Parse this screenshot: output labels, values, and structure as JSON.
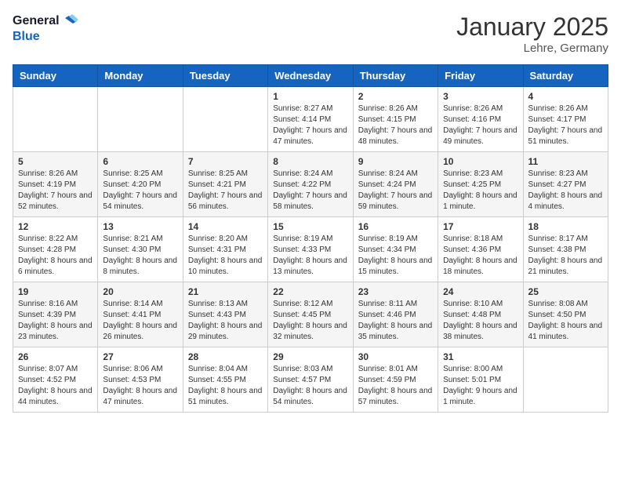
{
  "header": {
    "logo_general": "General",
    "logo_blue": "Blue",
    "month": "January 2025",
    "location": "Lehre, Germany"
  },
  "days_of_week": [
    "Sunday",
    "Monday",
    "Tuesday",
    "Wednesday",
    "Thursday",
    "Friday",
    "Saturday"
  ],
  "weeks": [
    [
      {
        "day": "",
        "sunrise": "",
        "sunset": "",
        "daylight": ""
      },
      {
        "day": "",
        "sunrise": "",
        "sunset": "",
        "daylight": ""
      },
      {
        "day": "",
        "sunrise": "",
        "sunset": "",
        "daylight": ""
      },
      {
        "day": "1",
        "sunrise": "Sunrise: 8:27 AM",
        "sunset": "Sunset: 4:14 PM",
        "daylight": "Daylight: 7 hours and 47 minutes."
      },
      {
        "day": "2",
        "sunrise": "Sunrise: 8:26 AM",
        "sunset": "Sunset: 4:15 PM",
        "daylight": "Daylight: 7 hours and 48 minutes."
      },
      {
        "day": "3",
        "sunrise": "Sunrise: 8:26 AM",
        "sunset": "Sunset: 4:16 PM",
        "daylight": "Daylight: 7 hours and 49 minutes."
      },
      {
        "day": "4",
        "sunrise": "Sunrise: 8:26 AM",
        "sunset": "Sunset: 4:17 PM",
        "daylight": "Daylight: 7 hours and 51 minutes."
      }
    ],
    [
      {
        "day": "5",
        "sunrise": "Sunrise: 8:26 AM",
        "sunset": "Sunset: 4:19 PM",
        "daylight": "Daylight: 7 hours and 52 minutes."
      },
      {
        "day": "6",
        "sunrise": "Sunrise: 8:25 AM",
        "sunset": "Sunset: 4:20 PM",
        "daylight": "Daylight: 7 hours and 54 minutes."
      },
      {
        "day": "7",
        "sunrise": "Sunrise: 8:25 AM",
        "sunset": "Sunset: 4:21 PM",
        "daylight": "Daylight: 7 hours and 56 minutes."
      },
      {
        "day": "8",
        "sunrise": "Sunrise: 8:24 AM",
        "sunset": "Sunset: 4:22 PM",
        "daylight": "Daylight: 7 hours and 58 minutes."
      },
      {
        "day": "9",
        "sunrise": "Sunrise: 8:24 AM",
        "sunset": "Sunset: 4:24 PM",
        "daylight": "Daylight: 7 hours and 59 minutes."
      },
      {
        "day": "10",
        "sunrise": "Sunrise: 8:23 AM",
        "sunset": "Sunset: 4:25 PM",
        "daylight": "Daylight: 8 hours and 1 minute."
      },
      {
        "day": "11",
        "sunrise": "Sunrise: 8:23 AM",
        "sunset": "Sunset: 4:27 PM",
        "daylight": "Daylight: 8 hours and 4 minutes."
      }
    ],
    [
      {
        "day": "12",
        "sunrise": "Sunrise: 8:22 AM",
        "sunset": "Sunset: 4:28 PM",
        "daylight": "Daylight: 8 hours and 6 minutes."
      },
      {
        "day": "13",
        "sunrise": "Sunrise: 8:21 AM",
        "sunset": "Sunset: 4:30 PM",
        "daylight": "Daylight: 8 hours and 8 minutes."
      },
      {
        "day": "14",
        "sunrise": "Sunrise: 8:20 AM",
        "sunset": "Sunset: 4:31 PM",
        "daylight": "Daylight: 8 hours and 10 minutes."
      },
      {
        "day": "15",
        "sunrise": "Sunrise: 8:19 AM",
        "sunset": "Sunset: 4:33 PM",
        "daylight": "Daylight: 8 hours and 13 minutes."
      },
      {
        "day": "16",
        "sunrise": "Sunrise: 8:19 AM",
        "sunset": "Sunset: 4:34 PM",
        "daylight": "Daylight: 8 hours and 15 minutes."
      },
      {
        "day": "17",
        "sunrise": "Sunrise: 8:18 AM",
        "sunset": "Sunset: 4:36 PM",
        "daylight": "Daylight: 8 hours and 18 minutes."
      },
      {
        "day": "18",
        "sunrise": "Sunrise: 8:17 AM",
        "sunset": "Sunset: 4:38 PM",
        "daylight": "Daylight: 8 hours and 21 minutes."
      }
    ],
    [
      {
        "day": "19",
        "sunrise": "Sunrise: 8:16 AM",
        "sunset": "Sunset: 4:39 PM",
        "daylight": "Daylight: 8 hours and 23 minutes."
      },
      {
        "day": "20",
        "sunrise": "Sunrise: 8:14 AM",
        "sunset": "Sunset: 4:41 PM",
        "daylight": "Daylight: 8 hours and 26 minutes."
      },
      {
        "day": "21",
        "sunrise": "Sunrise: 8:13 AM",
        "sunset": "Sunset: 4:43 PM",
        "daylight": "Daylight: 8 hours and 29 minutes."
      },
      {
        "day": "22",
        "sunrise": "Sunrise: 8:12 AM",
        "sunset": "Sunset: 4:45 PM",
        "daylight": "Daylight: 8 hours and 32 minutes."
      },
      {
        "day": "23",
        "sunrise": "Sunrise: 8:11 AM",
        "sunset": "Sunset: 4:46 PM",
        "daylight": "Daylight: 8 hours and 35 minutes."
      },
      {
        "day": "24",
        "sunrise": "Sunrise: 8:10 AM",
        "sunset": "Sunset: 4:48 PM",
        "daylight": "Daylight: 8 hours and 38 minutes."
      },
      {
        "day": "25",
        "sunrise": "Sunrise: 8:08 AM",
        "sunset": "Sunset: 4:50 PM",
        "daylight": "Daylight: 8 hours and 41 minutes."
      }
    ],
    [
      {
        "day": "26",
        "sunrise": "Sunrise: 8:07 AM",
        "sunset": "Sunset: 4:52 PM",
        "daylight": "Daylight: 8 hours and 44 minutes."
      },
      {
        "day": "27",
        "sunrise": "Sunrise: 8:06 AM",
        "sunset": "Sunset: 4:53 PM",
        "daylight": "Daylight: 8 hours and 47 minutes."
      },
      {
        "day": "28",
        "sunrise": "Sunrise: 8:04 AM",
        "sunset": "Sunset: 4:55 PM",
        "daylight": "Daylight: 8 hours and 51 minutes."
      },
      {
        "day": "29",
        "sunrise": "Sunrise: 8:03 AM",
        "sunset": "Sunset: 4:57 PM",
        "daylight": "Daylight: 8 hours and 54 minutes."
      },
      {
        "day": "30",
        "sunrise": "Sunrise: 8:01 AM",
        "sunset": "Sunset: 4:59 PM",
        "daylight": "Daylight: 8 hours and 57 minutes."
      },
      {
        "day": "31",
        "sunrise": "Sunrise: 8:00 AM",
        "sunset": "Sunset: 5:01 PM",
        "daylight": "Daylight: 9 hours and 1 minute."
      },
      {
        "day": "",
        "sunrise": "",
        "sunset": "",
        "daylight": ""
      }
    ]
  ]
}
